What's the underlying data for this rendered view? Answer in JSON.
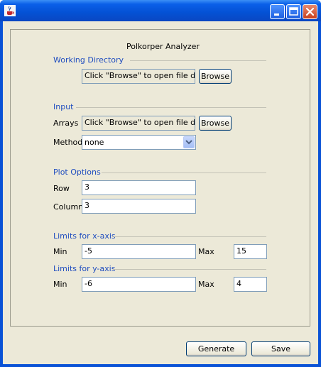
{
  "window": {
    "title": ""
  },
  "app": {
    "heading": "Polkorper Analyzer"
  },
  "working_directory": {
    "section_label": "Working Directory",
    "path_value": "Click \"Browse\" to open file dialog",
    "browse_label": "Browse"
  },
  "input": {
    "section_label": "Input",
    "arrays_label": "Arrays",
    "arrays_value": "Click \"Browse\" to open file dialog",
    "browse_label": "Browse",
    "method_label": "Method",
    "method_value": "none"
  },
  "plot_options": {
    "section_label": "Plot Options",
    "row_label": "Row",
    "row_value": "3",
    "column_label": "Column",
    "column_value": "3"
  },
  "x_axis": {
    "section_label": "Limits for x-axis",
    "min_label": "Min",
    "min_value": "-5",
    "max_label": "Max",
    "max_value": "15"
  },
  "y_axis": {
    "section_label": "Limits for y-axis",
    "min_label": "Min",
    "min_value": "-6",
    "max_label": "Max",
    "max_value": "4"
  },
  "footer": {
    "generate_label": "Generate",
    "save_label": "Save"
  },
  "colors": {
    "titlebar": "#0a5fe8",
    "section_text": "#1f4dbf",
    "background": "#ece9d8",
    "close_button": "#c8401e"
  },
  "icons": {
    "app": "java-cup-icon",
    "minimize": "minimize-icon",
    "maximize": "maximize-icon",
    "close": "close-icon",
    "dropdown": "chevron-down-icon"
  }
}
